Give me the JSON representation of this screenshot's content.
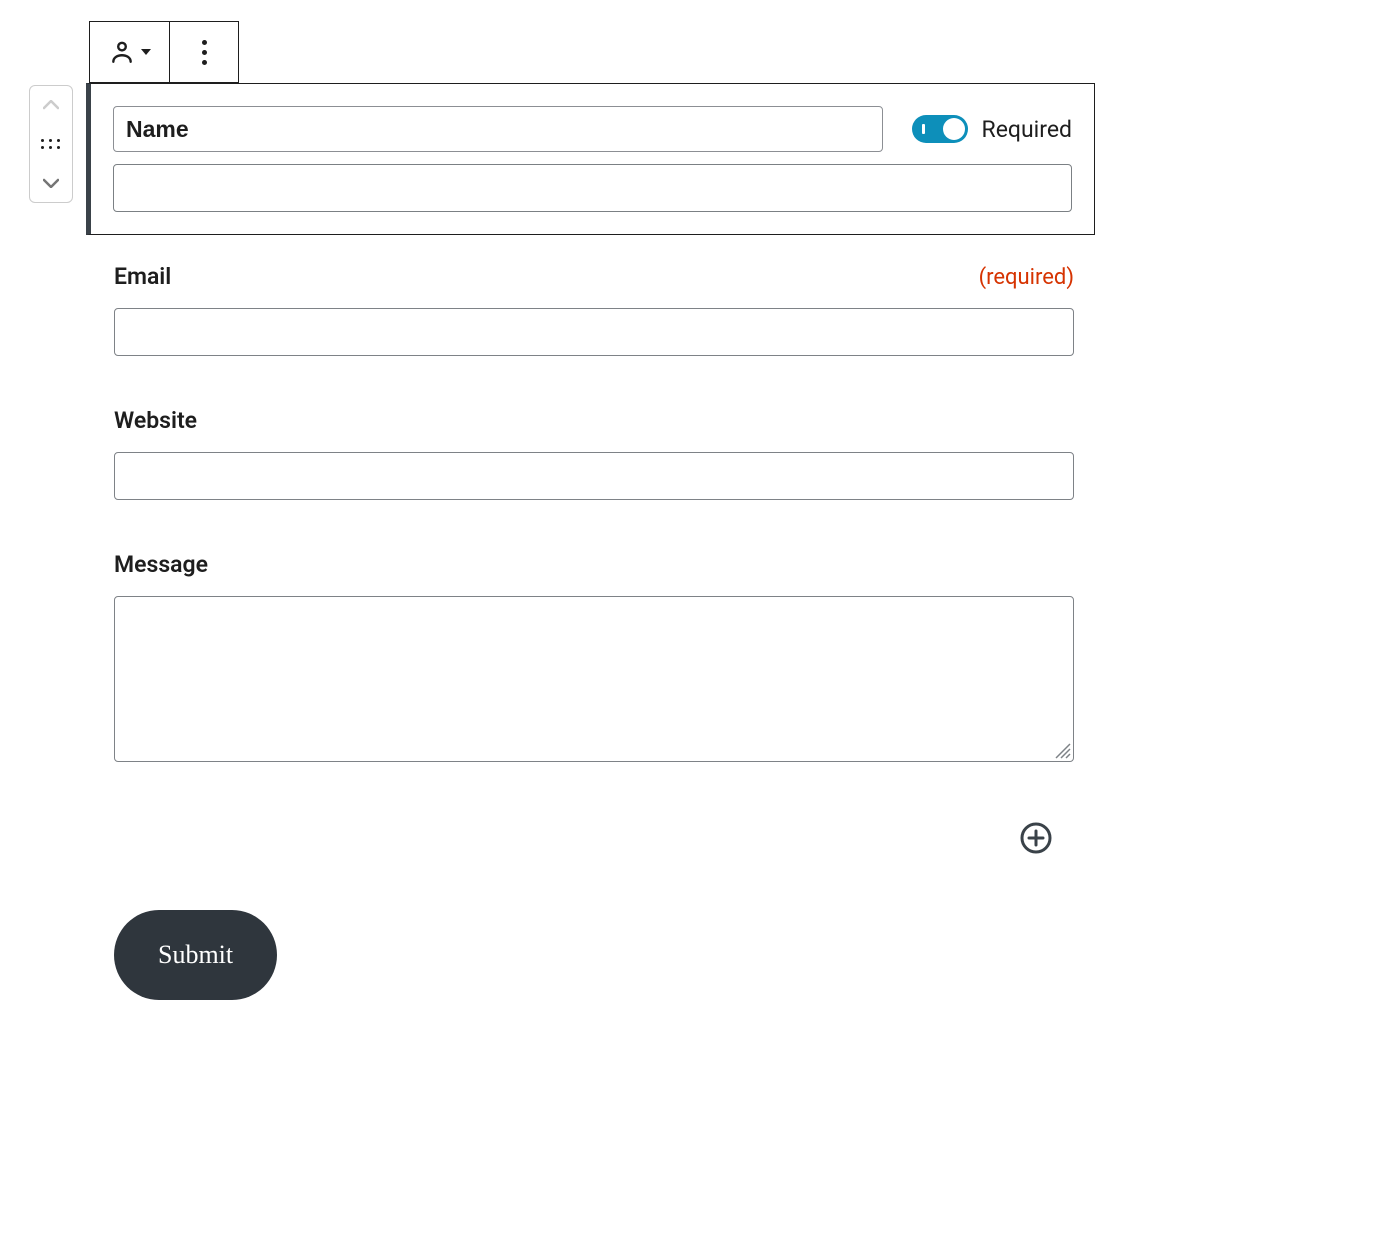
{
  "selectedField": {
    "label": "Name",
    "requiredToggleLabel": "Required",
    "requiredOn": true
  },
  "fields": {
    "email": {
      "label": "Email",
      "requiredText": "(required)"
    },
    "website": {
      "label": "Website"
    },
    "message": {
      "label": "Message"
    }
  },
  "submit": {
    "label": "Submit"
  }
}
